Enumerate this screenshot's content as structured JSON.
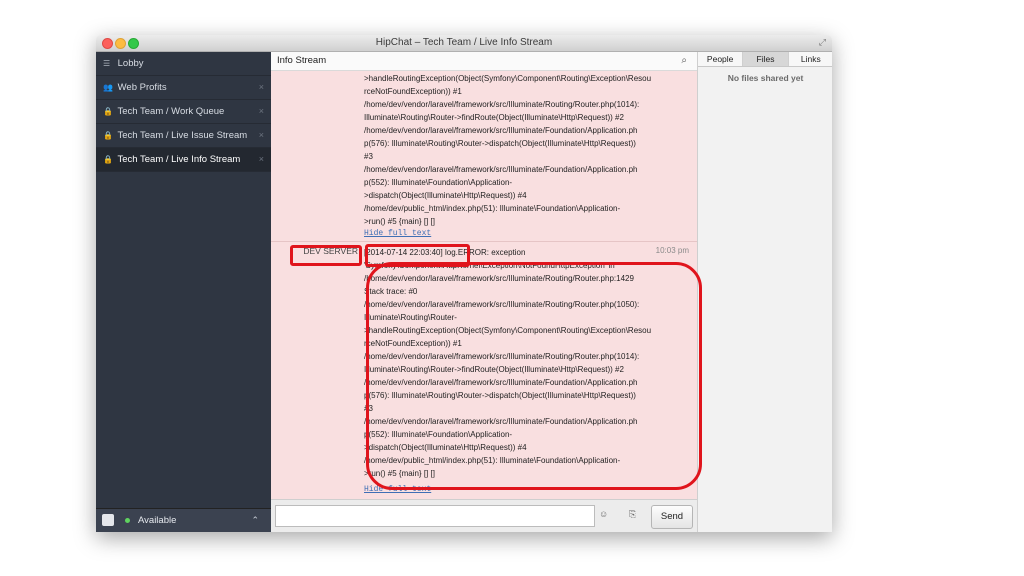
{
  "window": {
    "title": "HipChat – Tech Team / Live Info Stream"
  },
  "sidebar": {
    "items": [
      {
        "label": "Lobby",
        "icon": "list-icon",
        "closable": false
      },
      {
        "label": "Web Profits",
        "icon": "people-icon",
        "closable": true
      },
      {
        "label": "Tech Team / Work Queue",
        "icon": "lock-icon",
        "closable": true
      },
      {
        "label": "Tech Team / Live Issue Stream",
        "icon": "lock-icon",
        "closable": true
      },
      {
        "label": "Tech Team / Live Info Stream",
        "icon": "lock-icon",
        "closable": true,
        "active": true
      }
    ],
    "status": "Available"
  },
  "main": {
    "room_title": "Info Stream",
    "messages": [
      {
        "sender": "",
        "time": "",
        "lines": [
          ">handleRoutingException(Object(Symfony\\Component\\Routing\\Exception\\Resou",
          "rceNotFoundException)) #1",
          "/home/dev/vendor/laravel/framework/src/Illuminate/Routing/Router.php(1014):",
          "Illuminate\\Routing\\Router->findRoute(Object(Illuminate\\Http\\Request)) #2",
          "/home/dev/vendor/laravel/framework/src/Illuminate/Foundation/Application.ph",
          "p(576): Illuminate\\Routing\\Router->dispatch(Object(Illuminate\\Http\\Request))",
          "#3",
          "/home/dev/vendor/laravel/framework/src/Illuminate/Foundation/Application.ph",
          "p(552): Illuminate\\Foundation\\Application-",
          ">dispatch(Object(Illuminate\\Http\\Request)) #4",
          "/home/dev/public_html/index.php(51): Illuminate\\Foundation\\Application-",
          ">run() #5 {main} [] []"
        ],
        "hide_label": "Hide full text"
      },
      {
        "sender": "DEV SERVER",
        "time": "10:03 pm",
        "timestamp": "[2014-07-14 22:03:40]",
        "first_line_rest": "log.ERROR: exception",
        "lines": [
          "'Symfony\\Component\\HttpKernel\\Exception\\NotFoundHttpException' in",
          "/home/dev/vendor/laravel/framework/src/Illuminate/Routing/Router.php:1429",
          "Stack trace: #0",
          "/home/dev/vendor/laravel/framework/src/Illuminate/Routing/Router.php(1050):",
          "Illuminate\\Routing\\Router-",
          ">handleRoutingException(Object(Symfony\\Component\\Routing\\Exception\\Resou",
          "rceNotFoundException)) #1",
          "/home/dev/vendor/laravel/framework/src/Illuminate/Routing/Router.php(1014):",
          "Illuminate\\Routing\\Router->findRoute(Object(Illuminate\\Http\\Request)) #2",
          "/home/dev/vendor/laravel/framework/src/Illuminate/Foundation/Application.ph",
          "p(576): Illuminate\\Routing\\Router->dispatch(Object(Illuminate\\Http\\Request))",
          "#3",
          "/home/dev/vendor/laravel/framework/src/Illuminate/Foundation/Application.ph",
          "p(552): Illuminate\\Foundation\\Application-",
          ">dispatch(Object(Illuminate\\Http\\Request)) #4",
          "/home/dev/public_html/index.php(51): Illuminate\\Foundation\\Application-",
          ">run() #5 {main} [] []"
        ],
        "hide_label": "Hide full text"
      }
    ],
    "composer": {
      "send_label": "Send",
      "emoji_icon": "smiley-icon",
      "attach_icon": "paperclip-icon"
    }
  },
  "right_panel": {
    "tabs": [
      {
        "label": "People"
      },
      {
        "label": "Files",
        "selected": true
      },
      {
        "label": "Links"
      }
    ],
    "empty_text": "No files shared yet"
  },
  "colors": {
    "annotation": "#e0141c",
    "message_bg": "#f9dfe0",
    "sidebar_bg": "#2f3642"
  }
}
